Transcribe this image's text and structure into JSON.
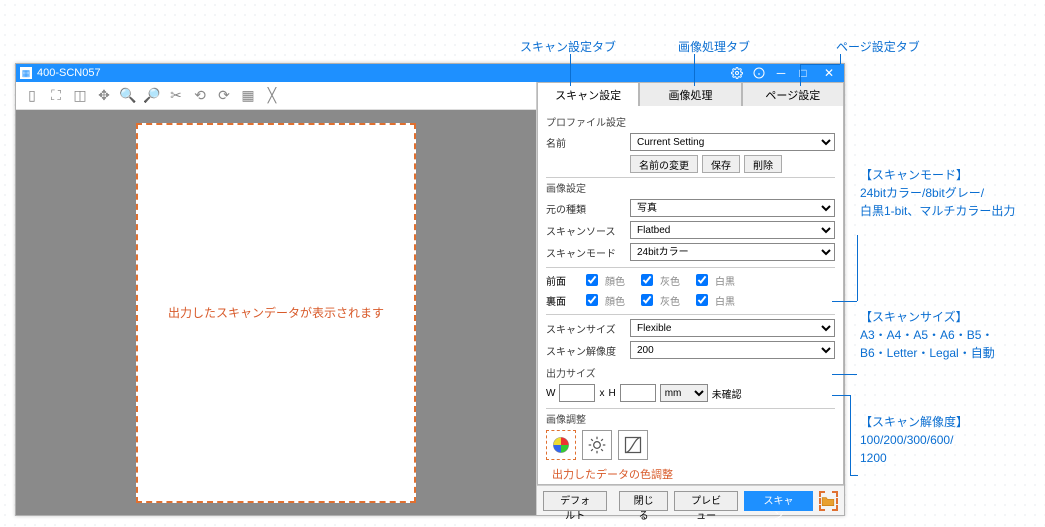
{
  "callouts": {
    "tab_scan": "スキャン設定タブ",
    "tab_image": "画像処理タブ",
    "tab_page": "ページ設定タブ"
  },
  "window": {
    "title": "400-SCN057"
  },
  "tabs": {
    "scan": "スキャン設定",
    "image": "画像処理",
    "page": "ページ設定"
  },
  "profile": {
    "group": "プロファイル設定",
    "name_label": "名前",
    "name_value": "Current Setting",
    "rename": "名前の変更",
    "save": "保存",
    "delete": "削除"
  },
  "image": {
    "group": "画像設定",
    "source_type_label": "元の種類",
    "source_type_value": "写真",
    "scan_source_label": "スキャンソース",
    "scan_source_value": "Flatbed",
    "scan_mode_label": "スキャンモード",
    "scan_mode_value": "24bitカラー"
  },
  "sides": {
    "front": "前面",
    "back": "裏面",
    "color": "顔色",
    "gray": "灰色",
    "bw": "白黒"
  },
  "size": {
    "scan_size_label": "スキャンサイズ",
    "scan_size_value": "Flexible",
    "resolution_label": "スキャン解像度",
    "resolution_value": "200",
    "output_group": "出力サイズ",
    "w_label": "W",
    "h_label": "H",
    "x_label": "x",
    "unit_value": "mm",
    "unverified": "未確認"
  },
  "adjust": {
    "group": "画像調整",
    "note": "出力したデータの色調整"
  },
  "preview": {
    "placeholder": "出力したスキャンデータが表示されます"
  },
  "bottom": {
    "default": "デフォルト",
    "close": "閉じる",
    "preview": "プレビュー",
    "scan": "スキャン"
  },
  "anno": {
    "mode_title": "【スキャンモード】",
    "mode_body": "24bitカラー/8bitグレー/\n白黒1-bit、マルチカラー出力",
    "size_title": "【スキャンサイズ】",
    "size_body": "A3・A4・A5・A6・B5・\nB6・Letter・Legal・自動",
    "res_title": "【スキャン解像度】",
    "res_body": "100/200/300/600/\n1200"
  }
}
